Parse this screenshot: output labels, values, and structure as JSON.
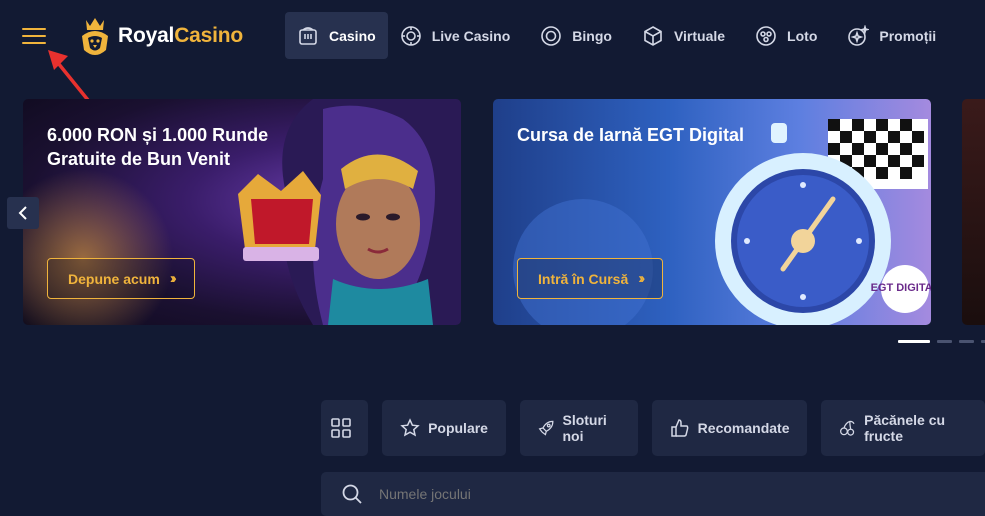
{
  "header": {
    "logo_text_1": "Royal",
    "logo_text_2": "Casino",
    "nav": [
      {
        "label": "Casino",
        "icon": "slot-machine-icon",
        "active": true
      },
      {
        "label": "Live Casino",
        "icon": "chip-icon"
      },
      {
        "label": "Bingo",
        "icon": "bingo-ball-icon"
      },
      {
        "label": "Virtuale",
        "icon": "cube-icon"
      },
      {
        "label": "Loto",
        "icon": "lotto-balls-icon"
      },
      {
        "label": "Promoții",
        "icon": "sparkle-icon"
      }
    ]
  },
  "banners": [
    {
      "title": "6.000 RON și 1.000 Runde Gratuite de Bun Venit",
      "button": "Depune acum"
    },
    {
      "title": "Cursa de Iarnă EGT Digital",
      "button": "Intră în Cursă",
      "badge": "EGT DIGITAL"
    }
  ],
  "categories": [
    {
      "label": "",
      "icon": "grid-icon"
    },
    {
      "label": "Populare",
      "icon": "star-icon"
    },
    {
      "label": "Sloturi noi",
      "icon": "rocket-icon"
    },
    {
      "label": "Recomandate",
      "icon": "thumbs-up-icon"
    },
    {
      "label": "Păcănele cu fructe",
      "icon": "cherry-icon"
    }
  ],
  "search": {
    "placeholder": "Numele jocului"
  },
  "colors": {
    "accent": "#f0b43c",
    "background": "#121a33",
    "panel": "#1f2843"
  }
}
